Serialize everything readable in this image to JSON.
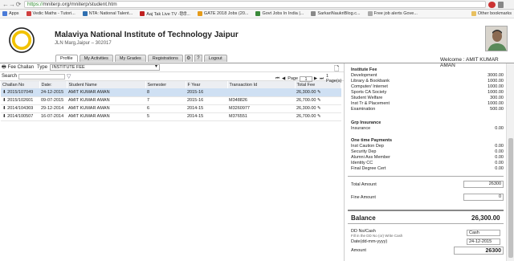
{
  "browser": {
    "url_scheme": "https://",
    "url_host": "mniterp.org",
    "url_path": "/mniterp/student.htm"
  },
  "bookmarks": [
    {
      "label": "Apps",
      "color": "#4a7bd8"
    },
    {
      "label": "Vedic Maths - Tutori...",
      "color": "#d04040"
    },
    {
      "label": "NTA: National Talent...",
      "color": "#2f6fb0"
    },
    {
      "label": "Aaj Tak Live TV -हिंदी...",
      "color": "#c02020"
    },
    {
      "label": "GATE 2018 Jobs (20...",
      "color": "#e59b1a"
    },
    {
      "label": "Govt Jobs In India |...",
      "color": "#3a8a3a"
    },
    {
      "label": "SarkariNaukriBlog.c...",
      "color": "#888888"
    },
    {
      "label": "Free job alerts Gove...",
      "color": "#aaaaaa"
    }
  ],
  "other_bookmarks": "Other bookmarks",
  "header": {
    "institute": "Malaviya National Institute of Technology Jaipur",
    "address": "JLN Marg,Jaipur – 302017",
    "welcome": "Welcome : AMIT KUMAR AMAN"
  },
  "tabs": [
    "Profile",
    "My Activities",
    "My Grades",
    "Registrations",
    "Logout"
  ],
  "toolbar": {
    "fee_challan": "Fee Challan",
    "type_label": "Type",
    "type_value": "INSTITUTE FEE"
  },
  "search": {
    "label": "Search",
    "page_label": "Page",
    "page_value": "1",
    "of_pages": "1 Page(s)"
  },
  "grid": {
    "columns": [
      "Challan No",
      "Date:",
      "Student Name",
      "Semester",
      "F Year",
      "Transaction Id",
      "Total Fee"
    ],
    "rows": [
      {
        "challan": "2015/107049",
        "date": "24-12-2015",
        "name": "AMIT KUMAR AMAN",
        "sem": "8",
        "fyear": "2015-16",
        "txn": "",
        "fee": "26,300.00"
      },
      {
        "challan": "2015/102601",
        "date": "09-07-2015",
        "name": "AMIT KUMAR AMAN",
        "sem": "7",
        "fyear": "2015-16",
        "txn": "M348826",
        "fee": "26,700.00"
      },
      {
        "challan": "2014/104369",
        "date": "29-12-2014",
        "name": "AMIT KUMAR AMAN",
        "sem": "6",
        "fyear": "2014-15",
        "txn": "M3260977",
        "fee": "26,300.00"
      },
      {
        "challan": "2014/100507",
        "date": "16-07-2014",
        "name": "AMIT KUMAR AMAN",
        "sem": "5",
        "fyear": "2014-15",
        "txn": "M376551",
        "fee": "26,700.00"
      }
    ]
  },
  "fees": {
    "institute_title": "Institute Fee",
    "institute": [
      {
        "label": "Development",
        "value": "3000.00"
      },
      {
        "label": "Library & Bookbank",
        "value": "1000.00"
      },
      {
        "label": "Computer/ Internet",
        "value": "1000.00"
      },
      {
        "label": "Sports CA Society",
        "value": "1000.00"
      },
      {
        "label": "Student Welfare",
        "value": "300.00"
      },
      {
        "label": "Inst Tr & Placement",
        "value": "1000.00"
      },
      {
        "label": "Examination",
        "value": "500.00"
      }
    ],
    "grp_title": "Grp Insurance",
    "grp": [
      {
        "label": "Insurance",
        "value": "0.00"
      }
    ],
    "onetime_title": "One time Payments",
    "onetime": [
      {
        "label": "Inst Caution Dep",
        "value": "0.00"
      },
      {
        "label": "Security Dep",
        "value": "0.00"
      },
      {
        "label": "Alumni Ass Member",
        "value": "0.00"
      },
      {
        "label": "Identity CC",
        "value": "0.00"
      },
      {
        "label": "Final Degree Cert",
        "value": "0.00"
      }
    ],
    "total_label": "Total Amount",
    "total_value": "26300",
    "fine_label": "Fine Amount",
    "fine_value": "0",
    "balance_label": "Balance",
    "balance_value": "26,300.00",
    "dd_label": "DD No/Cash",
    "dd_hint": "Fill in the DD No (or) Write Cash",
    "dd_value": "Cash",
    "date_label": "Date(dd-mm-yyyy)",
    "date_value": "24-12-2015",
    "amount_label": "Amount",
    "amount_value": "26300"
  }
}
